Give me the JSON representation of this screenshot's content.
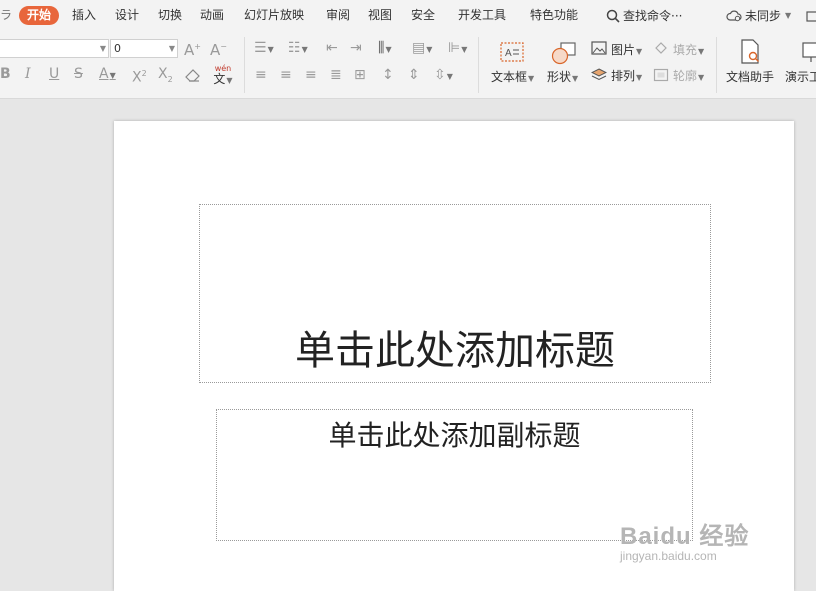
{
  "menubar": {
    "items": [
      {
        "label": "开始",
        "active": true
      },
      {
        "label": "插入"
      },
      {
        "label": "设计"
      },
      {
        "label": "切换"
      },
      {
        "label": "动画"
      },
      {
        "label": "幻灯片放映"
      },
      {
        "label": "审阅"
      },
      {
        "label": "视图"
      },
      {
        "label": "安全"
      },
      {
        "label": "开发工具"
      },
      {
        "label": "特色功能"
      }
    ],
    "search_label": "查找命令···",
    "sync_label": "未同步"
  },
  "ribbon": {
    "font_name_value": "",
    "font_size_value": "0",
    "phonetic_glyph_top": "wén",
    "phonetic_glyph_bottom": "文",
    "textbox_label": "文本框",
    "shape_label": "形状",
    "picture_label": "图片",
    "arrange_label": "排列",
    "fill_label": "填充",
    "outline_label": "轮廓",
    "doc_helper_label": "文档助手",
    "presentation_tool_label": "演示工"
  },
  "slide": {
    "title_placeholder": "单击此处添加标题",
    "subtitle_placeholder": "单击此处添加副标题"
  },
  "watermark": {
    "brand": "Baidu 经验",
    "url": "jingyan.baidu.com"
  },
  "colors": {
    "accent": "#e8663b",
    "menubar_bg": "#f3f3f3",
    "workspace_bg": "#e6e6e6"
  }
}
